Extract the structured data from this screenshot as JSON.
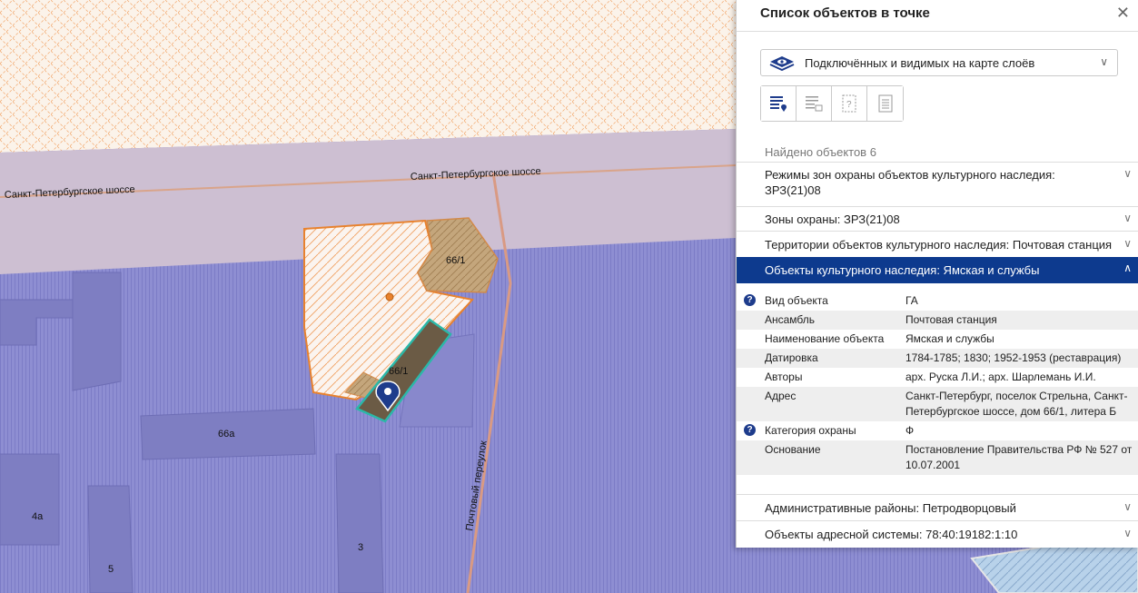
{
  "map": {
    "road_label_left": "Санкт-Петербургское шоссе",
    "road_label_right": "Санкт-Петербургское шоссе",
    "lane_label": "Почтовый переулок",
    "buildings": [
      "66/1",
      "66/1",
      "66а",
      "4а",
      "5",
      "3"
    ]
  },
  "panel": {
    "title": "Список объектов в точке",
    "close_icon": "close-icon",
    "layer_select": "Подключённых и видимых на карте слоёв",
    "found_text": "Найдено объектов 6",
    "sections": [
      {
        "label": "Режимы зон охраны объектов культурного наследия: ЗРЗ(21)08"
      },
      {
        "label": "Зоны охраны: ЗРЗ(21)08"
      },
      {
        "label": "Территории объектов культурного наследия: Почтовая станция"
      },
      {
        "label": "Объекты культурного наследия: Ямская и службы"
      }
    ],
    "attributes": [
      {
        "key": "Вид объекта",
        "value": "ГА"
      },
      {
        "key": "Ансамбль",
        "value": "Почтовая станция"
      },
      {
        "key": "Наименование объекта",
        "value": "Ямская и службы"
      },
      {
        "key": "Датировка",
        "value": "1784-1785; 1830; 1952-1953 (реставрация)"
      },
      {
        "key": "Авторы",
        "value": "арх. Руска Л.И.; арх. Шарлемань И.И."
      },
      {
        "key": "Адрес",
        "value": "Санкт-Петербург, поселок Стрельна, Санкт-Петербургское шоссе, дом 66/1, литера Б"
      },
      {
        "key": "Категория охраны",
        "value": "Ф"
      },
      {
        "key": "Основание",
        "value": "Постановление Правительства РФ № 527 от 10.07.2001"
      }
    ],
    "help_mark": "?",
    "bottom_sections": [
      {
        "label": "Административные районы: Петродворцовый"
      },
      {
        "label": "Объекты адресной системы: 78:40:19182:1:10"
      }
    ],
    "colors": {
      "accent": "#0d3a8e"
    }
  }
}
